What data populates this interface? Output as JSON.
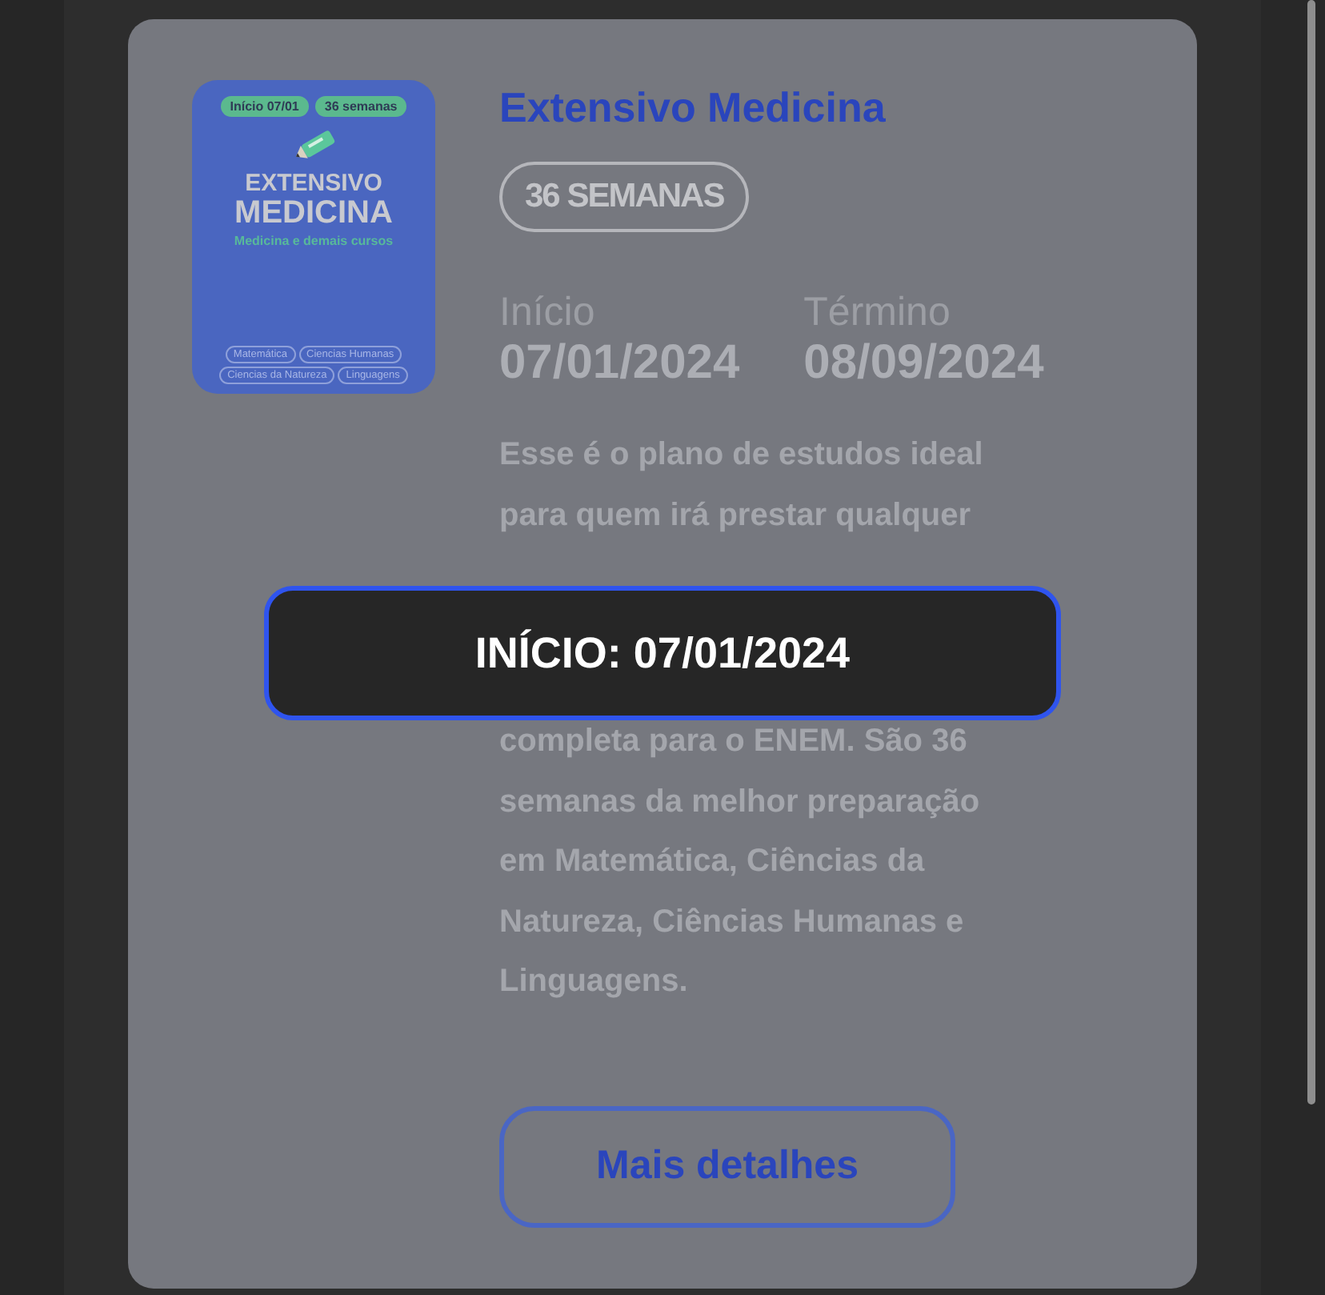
{
  "course": {
    "cover": {
      "pills": [
        "Início 07/01",
        "36 semanas"
      ],
      "heading_top": "EXTENSIVO",
      "heading_main": "MEDICINA",
      "subtitle": "Medicina e demais cursos",
      "tags": [
        "Matemática",
        "Ciencias Humanas",
        "Ciencias da Natureza",
        "Linguagens"
      ]
    },
    "title": "Extensivo Medicina",
    "badge": "36 SEMANAS",
    "dates": [
      {
        "label": "Início",
        "value": "07/01/2024"
      },
      {
        "label": "Término",
        "value": "08/09/2024"
      }
    ],
    "description_before": [
      "Esse é o plano de estudos ideal",
      "para quem irá prestar qualquer"
    ],
    "description_after": [
      "completa para o ENEM. São 36",
      "semanas da melhor preparação",
      "em Matemática, Ciências da",
      "Natureza, Ciências Humanas e",
      "Linguagens."
    ],
    "button": "Mais detalhes"
  },
  "toast": {
    "text": "INÍCIO: 07/01/2024"
  }
}
